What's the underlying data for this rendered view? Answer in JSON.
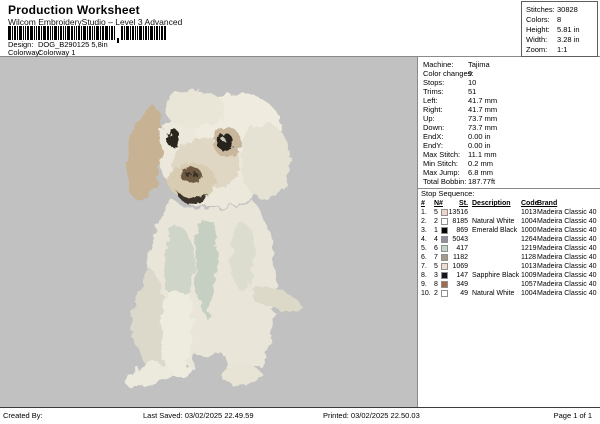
{
  "header": {
    "title": "Production Worksheet",
    "subtitle": "Wilcom EmbroideryStudio – Level 3 Advanced",
    "design_label": "Design:",
    "design_value": "DOG_B290125 5,8in",
    "colorway_label": "Colorway:",
    "colorway_value": "Colorway 1"
  },
  "stats": {
    "rows": [
      {
        "label": "Stitches:",
        "value": "30828"
      },
      {
        "label": "Colors:",
        "value": "8"
      },
      {
        "label": "Height:",
        "value": "5.81 in"
      },
      {
        "label": "Width:",
        "value": "3.28 in"
      },
      {
        "label": "Zoom:",
        "value": "1:1"
      }
    ]
  },
  "machine_info": {
    "rows": [
      {
        "label": "Machine:",
        "value": "Tajima"
      },
      {
        "label": "Color changes:",
        "value": "9"
      },
      {
        "label": "Stops:",
        "value": "10"
      },
      {
        "label": "Trims:",
        "value": "51"
      },
      {
        "label": "Left:",
        "value": "41.7 mm"
      },
      {
        "label": "Right:",
        "value": "41.7 mm"
      },
      {
        "label": "Up:",
        "value": "73.7 mm"
      },
      {
        "label": "Down:",
        "value": "73.7 mm"
      },
      {
        "label": "EndX:",
        "value": "0.00 in"
      },
      {
        "label": "EndY:",
        "value": "0.00 in"
      },
      {
        "label": "Max Stitch:",
        "value": "11.1 mm"
      },
      {
        "label": "Min Stitch:",
        "value": "0.2 mm"
      },
      {
        "label": "Max Jump:",
        "value": "6.8 mm"
      },
      {
        "label": "Total Bobbin:",
        "value": "187.77ft"
      }
    ]
  },
  "stop_sequence": {
    "title": "Stop Sequence:",
    "columns": {
      "num": "#",
      "n": "N#",
      "st": "St.",
      "desc": "Description",
      "code": "Code",
      "brand": "Brand"
    },
    "rows": [
      {
        "num": "1.",
        "n": "5",
        "color": "#eed5ca",
        "st": "13516",
        "desc": "",
        "code": "1013",
        "brand": "Madeira Classic 40"
      },
      {
        "num": "2.",
        "n": "2",
        "color": "#ffffff",
        "st": "8185",
        "desc": "Natural White",
        "code": "1004",
        "brand": "Madeira Classic 40"
      },
      {
        "num": "3.",
        "n": "1",
        "color": "#050505",
        "st": "869",
        "desc": "Emerald Black",
        "code": "1000",
        "brand": "Madeira Classic 40"
      },
      {
        "num": "4.",
        "n": "4",
        "color": "#90909c",
        "st": "5043",
        "desc": "",
        "code": "1264",
        "brand": "Madeira Classic 40"
      },
      {
        "num": "5.",
        "n": "6",
        "color": "#c2d4cc",
        "st": "417",
        "desc": "",
        "code": "1219",
        "brand": "Madeira Classic 40"
      },
      {
        "num": "6.",
        "n": "7",
        "color": "#a89a8b",
        "st": "1182",
        "desc": "",
        "code": "1128",
        "brand": "Madeira Classic 40"
      },
      {
        "num": "7.",
        "n": "5",
        "color": "#f1dbd1",
        "st": "1069",
        "desc": "",
        "code": "1013",
        "brand": "Madeira Classic 40"
      },
      {
        "num": "8.",
        "n": "3",
        "color": "#15151d",
        "st": "147",
        "desc": "Sapphire Black",
        "code": "1009",
        "brand": "Madeira Classic 40"
      },
      {
        "num": "9.",
        "n": "8",
        "color": "#a06c4c",
        "st": "349",
        "desc": "",
        "code": "1057",
        "brand": "Madeira Classic 40"
      },
      {
        "num": "10.",
        "n": "2",
        "color": "#ffffff",
        "st": "49",
        "desc": "Natural White",
        "code": "1004",
        "brand": "Madeira Classic 40"
      }
    ]
  },
  "footer": {
    "created_by": "Created By:",
    "last_saved": "Last Saved: 03/02/2025 22.49.59",
    "printed": "Printed: 03/02/2025 22.50.03",
    "page": "Page 1 of 1"
  },
  "colors": {
    "canvas_background": "#c1c1c1",
    "panel_border": "#8a8a8a"
  }
}
